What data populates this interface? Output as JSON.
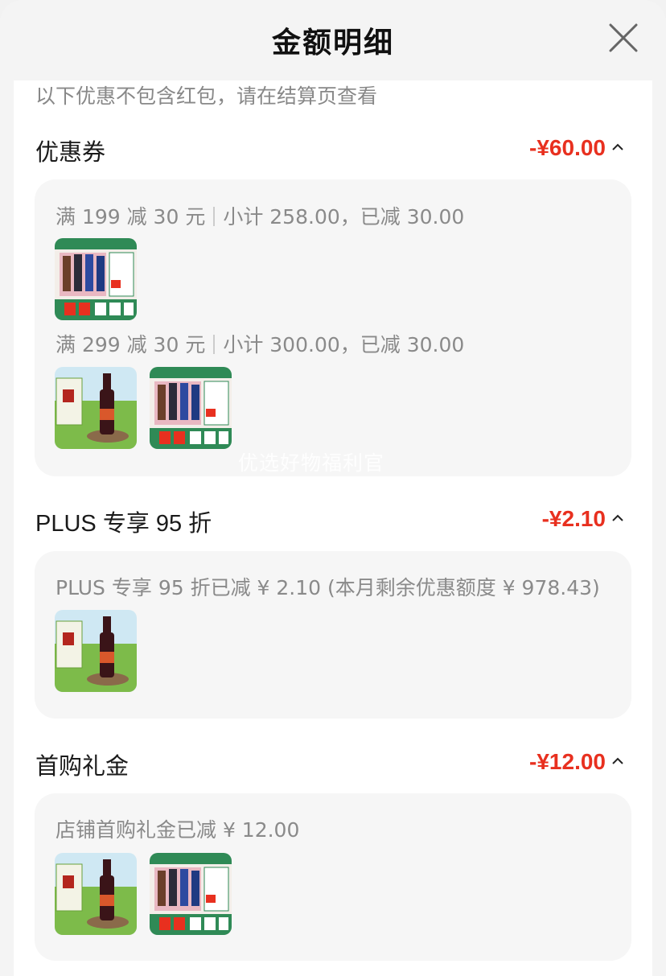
{
  "header": {
    "title": "金额明细"
  },
  "notice": "以下优惠不包含红包，请在结算页查看",
  "sections": [
    {
      "title": "优惠券",
      "amount": "-¥60.00",
      "rules": [
        {
          "main": "满 199 减 30 元",
          "detail": "小计 258.00，已减 30.00"
        },
        {
          "main": "满 299 减 30 元",
          "detail": "小计 300.00，已减 30.00"
        }
      ]
    },
    {
      "title": "PLUS 专享 95 折",
      "amount": "-¥2.10",
      "rules": [
        {
          "main": "PLUS 专享 95 折已减 ¥ 2.10 (本月剩余优惠额度 ¥ 978.43)"
        }
      ]
    },
    {
      "title": "首购礼金",
      "amount": "-¥12.00",
      "rules": [
        {
          "main": "店铺首购礼金已减 ¥ 12.00"
        }
      ]
    }
  ],
  "watermark": "优选好物福利官",
  "icons": {
    "close": "close-icon",
    "collapse": "chevron-up-icon"
  },
  "colors": {
    "discount_red": "#e8301f",
    "muted_text": "#8a8a8a",
    "card_bg": "#f6f6f6"
  }
}
